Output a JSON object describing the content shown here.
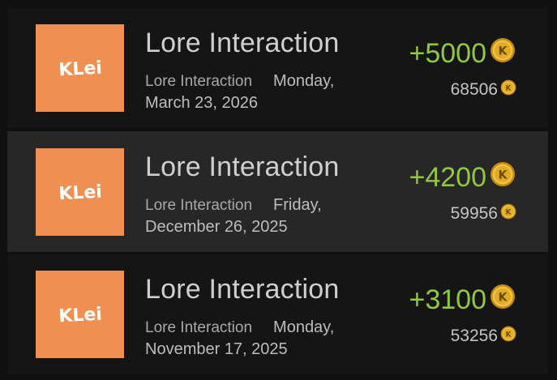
{
  "transactions": [
    {
      "brand": "KLei",
      "title": "Lore Interaction",
      "subtitle": "Lore Interaction",
      "date": "Monday, March 23, 2026",
      "amount": "+5000",
      "balance": "68506",
      "highlighted": false
    },
    {
      "brand": "KLei",
      "title": "Lore Interaction",
      "subtitle": "Lore Interaction",
      "date": "Friday, December 26, 2025",
      "amount": "+4200",
      "balance": "59956",
      "highlighted": true
    },
    {
      "brand": "KLei",
      "title": "Lore Interaction",
      "subtitle": "Lore Interaction",
      "date": "Monday, November 17, 2025",
      "amount": "+3100",
      "balance": "53256",
      "highlighted": false
    }
  ],
  "colors": {
    "background": "#101010",
    "row": "#151515",
    "row_highlight": "#272727",
    "logo_bg": "#ef8f52",
    "amount": "#92c83e",
    "coin_gold": "#d9a520"
  },
  "icons": {
    "currency": "klei-coin-icon",
    "brand": "klei-logo"
  }
}
